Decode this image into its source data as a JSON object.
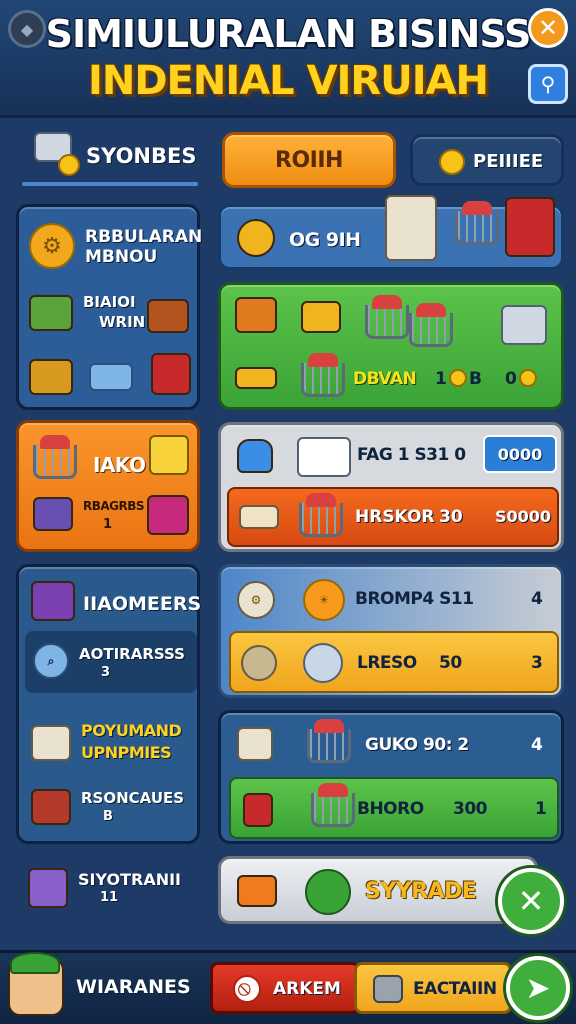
{
  "header": {
    "title_line1": "SIMIULURALAN BISINSS",
    "title_line2": "INDENIAL VIRUIAH"
  },
  "tabs": {
    "left_label": "SYONBES",
    "center_label": "ROIIH",
    "right_label": "PEIIIEE"
  },
  "left_panel_1": {
    "title_line1": "RBBULARAN",
    "title_line2": "MBNOU",
    "item1_line1": "BIAIOI",
    "item1_line2": "WRIN"
  },
  "left_panel_2": {
    "title": "IAKO",
    "sub_line1": "RBAGRBS",
    "sub_line2": "1"
  },
  "left_panel_3": {
    "title": "IIAOMEERS",
    "row1_label": "AOTIRARSSS",
    "row1_value": "3",
    "row2_line1": "POYUMAND",
    "row2_line2": "UPNPMIES",
    "row3_label": "RSONCAUES",
    "row3_value": "B"
  },
  "left_panel_4": {
    "label": "SIYOTRANII",
    "value": "11"
  },
  "right_row_1": {
    "label": "OG 9IH"
  },
  "right_row_2": {
    "label": "DBVAN",
    "val1": "1",
    "val2": "B",
    "counter": "0"
  },
  "right_row_3": {
    "label": "FAG 1 S31 0",
    "value": "0000"
  },
  "right_row_4": {
    "label": "HRSKOR",
    "amount": "30",
    "price": "S0000"
  },
  "right_row_5": {
    "label": "BROMP4 S11",
    "value": "4"
  },
  "right_row_6": {
    "label": "LRESO",
    "amount": "50",
    "value": "3"
  },
  "right_row_7": {
    "label": "GUKO 90: 2",
    "value": "4"
  },
  "right_row_8": {
    "label": "BHORO",
    "amount": "300",
    "value": "1"
  },
  "right_row_9": {
    "label": "SYYRADE"
  },
  "footer": {
    "label": "WIARANES",
    "btn1_label": "ARKEM",
    "btn2_label": "EACTAIIN"
  },
  "colors": {
    "green": "#3fae3c",
    "orange": "#f4871e",
    "yellow": "#f7b81e",
    "blue_panel": "#2d5d98"
  }
}
